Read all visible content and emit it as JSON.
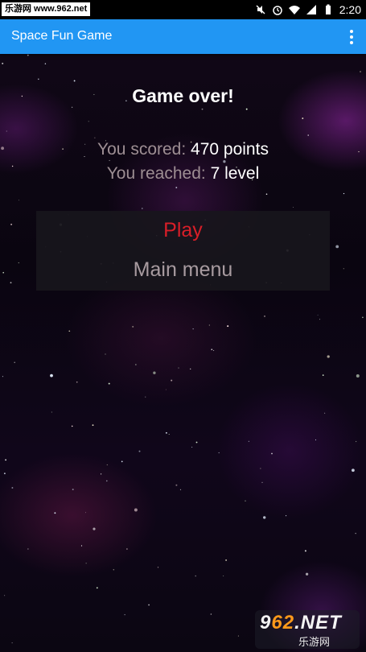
{
  "status_bar": {
    "watermark_text": "乐游网 www.962.net",
    "time": "2:20",
    "icons": [
      "mute-icon",
      "alarm-icon",
      "wifi-icon",
      "signal-icon",
      "battery-icon"
    ]
  },
  "app_bar": {
    "title": "Space Fun Game",
    "menu_icon": "more-vert-icon",
    "color": "#2196f3"
  },
  "game_over": {
    "title": "Game over!",
    "score_label": "You scored:",
    "score_value": "470 points",
    "level_label": "You reached:",
    "level_value": "7 level"
  },
  "menu": {
    "play_label": "Play",
    "main_menu_label": "Main menu",
    "play_color": "#d81e28",
    "main_menu_color": "#a89ba0"
  },
  "watermark": {
    "top_prefix": "9",
    "top_number": "62",
    "top_suffix": ".NET",
    "bottom_text": "乐游网"
  }
}
